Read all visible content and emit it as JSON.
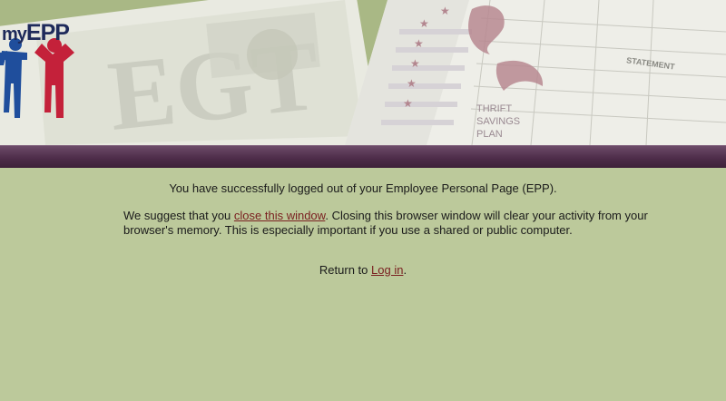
{
  "logo": {
    "text_my": "my",
    "text_epp": "EPP"
  },
  "banner": {
    "tsp_line1": "THRIFT",
    "tsp_line2": "SAVINGS",
    "tsp_line3": "PLAN",
    "statement_text": "STATEMENT"
  },
  "message": {
    "logout_text": "You have successfully logged out of your Employee Personal Page (EPP).",
    "suggest_prefix": "We suggest that you ",
    "close_window_link": "close this window",
    "suggest_suffix": ".  Closing this browser window will clear your activity from your browser's memory. This is especially important if you use a shared or public computer.",
    "return_prefix": "Return to ",
    "login_link": "Log in",
    "return_suffix": "."
  },
  "colors": {
    "page_background": "#bcc99b",
    "band": "#4e2d4a",
    "link": "#7a2020",
    "logo_blue": "#1f4e9c",
    "logo_red": "#c4213a"
  }
}
